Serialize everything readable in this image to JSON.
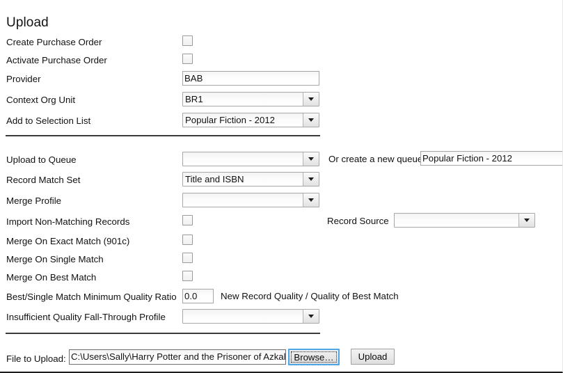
{
  "page": {
    "title": "Upload"
  },
  "section_order": {
    "purchase_order": {
      "create_purchase_order_label": "Create Purchase Order",
      "activate_purchase_order_label": "Activate Purchase Order",
      "provider_label": "Provider",
      "provider_value": "BAB",
      "context_org_unit_label": "Context Org Unit",
      "context_org_unit_value": "BR1",
      "add_to_selection_list_label": "Add to Selection List",
      "add_to_selection_list_value": "Popular Fiction - 2012"
    }
  },
  "section_queue": {
    "upload_to_queue_label": "Upload to Queue",
    "upload_to_queue_value": "",
    "or_create_new_queue_label": "Or create a new queue",
    "or_create_new_queue_value": "Popular Fiction - 2012",
    "record_match_set_label": "Record Match Set",
    "record_match_set_value": "Title and ISBN",
    "merge_profile_label": "Merge Profile",
    "merge_profile_value": "",
    "import_non_matching_label": "Import Non-Matching Records",
    "record_source_label": "Record Source",
    "record_source_value": "",
    "merge_on_exact_match_label": "Merge On Exact Match (901c)",
    "merge_on_single_match_label": "Merge On Single Match",
    "merge_on_best_match_label": "Merge On Best Match",
    "quality_ratio_label": "Best/Single Match Minimum Quality Ratio",
    "quality_ratio_value": "0.0",
    "quality_ratio_hint": "New Record Quality / Quality of Best Match",
    "fall_through_profile_label": "Insufficient Quality Fall-Through Profile",
    "fall_through_profile_value": ""
  },
  "section_file": {
    "file_to_upload_label": "File to Upload:",
    "file_path_value": "C:\\Users\\Sally\\Harry Potter and the Prisoner of Azkal",
    "browse_button_label": "Browse…",
    "upload_button_label": "Upload"
  },
  "colors": {
    "focus_ring": "#4ea6e8",
    "divider": "#3a3a3a",
    "field_border": "#a6a6a6",
    "text": "#111111"
  }
}
